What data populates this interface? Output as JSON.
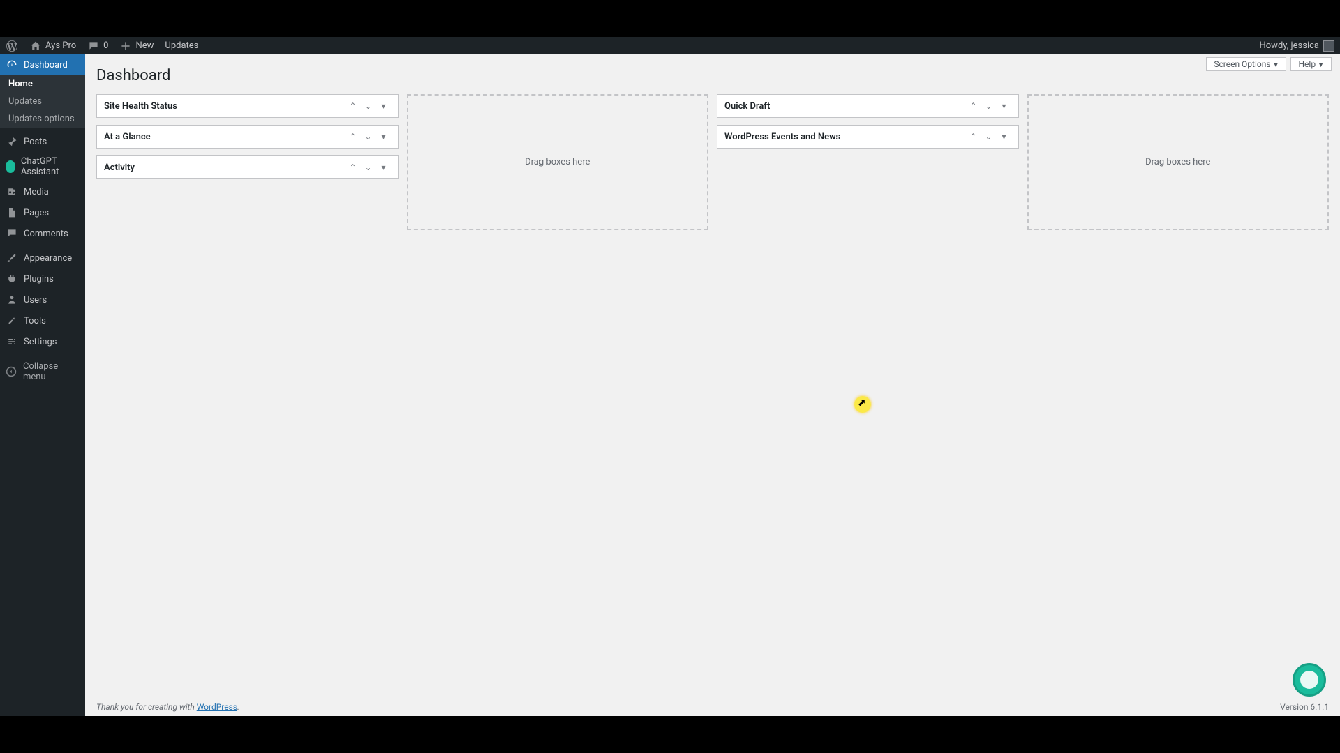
{
  "adminbar": {
    "site_name": "Ays Pro",
    "comments_count": "0",
    "new_label": "New",
    "updates_label": "Updates",
    "howdy": "Howdy, jessica"
  },
  "sidebar": {
    "dashboard": "Dashboard",
    "submenu": {
      "home": "Home",
      "updates": "Updates",
      "updates_options": "Updates options"
    },
    "posts": "Posts",
    "chatgpt": "ChatGPT Assistant",
    "media": "Media",
    "pages": "Pages",
    "comments": "Comments",
    "appearance": "Appearance",
    "plugins": "Plugins",
    "users": "Users",
    "tools": "Tools",
    "settings": "Settings",
    "collapse": "Collapse menu"
  },
  "top_controls": {
    "screen_options": "Screen Options",
    "help": "Help"
  },
  "page_title": "Dashboard",
  "widgets": {
    "col1": [
      {
        "title": "Site Health Status"
      },
      {
        "title": "At a Glance"
      },
      {
        "title": "Activity"
      }
    ],
    "col3": [
      {
        "title": "Quick Draft"
      },
      {
        "title": "WordPress Events and News"
      }
    ]
  },
  "dropzone_text": "Drag boxes here",
  "footer": {
    "thank_you": "Thank you for creating with ",
    "wp_link": "WordPress",
    "version": "Version 6.1.1"
  }
}
